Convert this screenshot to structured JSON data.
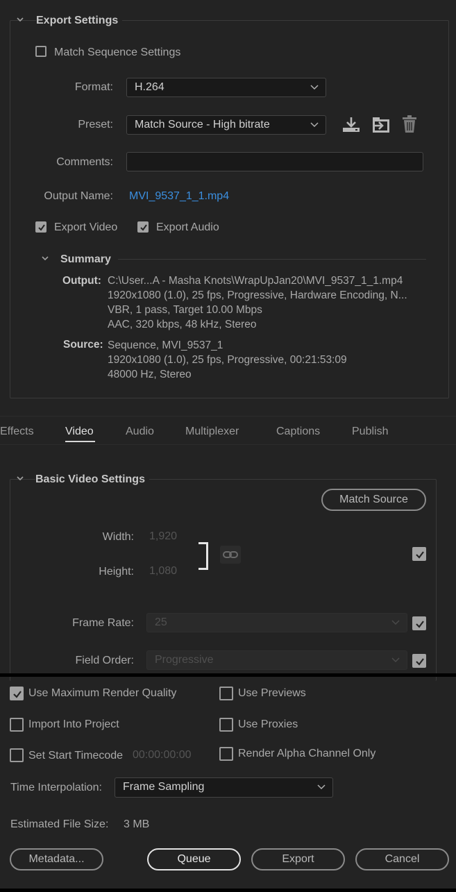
{
  "export_settings": {
    "title": "Export Settings",
    "match_sequence_label": "Match Sequence Settings",
    "format_label": "Format:",
    "format_value": "H.264",
    "preset_label": "Preset:",
    "preset_value": "Match Source - High bitrate",
    "comments_label": "Comments:",
    "comments_value": "",
    "output_name_label": "Output Name:",
    "output_name_value": "MVI_9537_1_1.mp4",
    "export_video_label": "Export Video",
    "export_audio_label": "Export Audio",
    "summary": {
      "title": "Summary",
      "output_label": "Output:",
      "output_lines": [
        "C:\\User...A - Masha Knots\\WrapUpJan20\\MVI_9537_1_1.mp4",
        "1920x1080 (1.0), 25 fps, Progressive, Hardware Encoding, N...",
        "VBR, 1 pass, Target 10.00 Mbps",
        "AAC, 320 kbps, 48 kHz, Stereo"
      ],
      "source_label": "Source:",
      "source_lines": [
        "Sequence, MVI_9537_1",
        "1920x1080 (1.0), 25 fps, Progressive, 00:21:53:09",
        "48000 Hz, Stereo"
      ]
    }
  },
  "tabs": [
    "Effects",
    "Video",
    "Audio",
    "Multiplexer",
    "Captions",
    "Publish"
  ],
  "active_tab": "Video",
  "video": {
    "section_title": "Basic Video Settings",
    "match_source_label": "Match Source",
    "width_label": "Width:",
    "width_value": "1,920",
    "height_label": "Height:",
    "height_value": "1,080",
    "frame_rate_label": "Frame Rate:",
    "frame_rate_value": "25",
    "field_order_label": "Field Order:",
    "field_order_value": "Progressive"
  },
  "bottom": {
    "use_max_render_quality": "Use Maximum Render Quality",
    "use_previews": "Use Previews",
    "import_into_project": "Import Into Project",
    "use_proxies": "Use Proxies",
    "set_start_timecode": "Set Start Timecode",
    "start_timecode_value": "00:00:00:00",
    "render_alpha_only": "Render Alpha Channel Only",
    "time_interpolation_label": "Time Interpolation:",
    "time_interpolation_value": "Frame Sampling",
    "estimated_size_label": "Estimated File Size:",
    "estimated_size_value": "3 MB",
    "metadata_button": "Metadata...",
    "queue_button": "Queue",
    "export_button": "Export",
    "cancel_button": "Cancel"
  },
  "colors": {
    "background": "#232323",
    "link": "#3b8fe0",
    "divider": "#000000"
  }
}
